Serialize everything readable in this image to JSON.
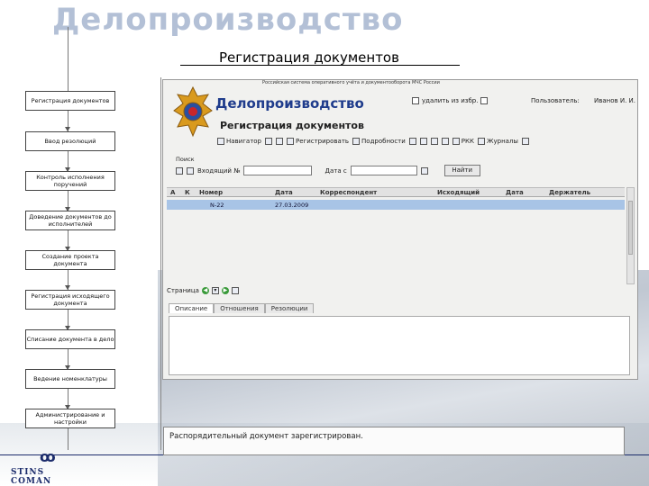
{
  "slide": {
    "title": "Делопроизводство",
    "subtitle": "Регистрация документов"
  },
  "process_steps": [
    "Регистрация документов",
    "Ввод резолюций",
    "Контроль исполнения поручений",
    "Доведение документов до исполнителей",
    "Создание проекта документа",
    "Регистрация исходящего документа",
    "Списание документа в дело",
    "Ведение номенклатуры",
    "Администрирование и настройки"
  ],
  "logo": {
    "mark": "ꝏ",
    "text": "STINS COMAN"
  },
  "app": {
    "top_text": "Российская система оперативного учёта и документооборота МЧС России",
    "title": "Делопроизводство",
    "section": "Регистрация документов",
    "favorites_label": "удалить из избр.",
    "user_label": "Пользователь:",
    "user_name": "Иванов И. И.",
    "toolbar": [
      "Навигатор",
      "Регистрировать",
      "Подробности",
      "РКК",
      "Журналы"
    ],
    "search": {
      "header": "Поиск",
      "incoming_label": "Входящий №",
      "incoming_value": "",
      "date_label": "Дата с",
      "date_value": "",
      "find_button": "Найти"
    },
    "grid": {
      "columns": [
        "А",
        "К",
        "Номер",
        "Дата",
        "Корреспондент",
        "Исходящий",
        "Дата",
        "Держатель"
      ],
      "rows": [
        {
          "number": "N-22",
          "date": "27.03.2009"
        }
      ]
    },
    "pager_label": "Страница",
    "tabs": [
      "Описание",
      "Отношения",
      "Резолюции"
    ]
  },
  "status_message": "Распорядительный документ зарегистрирован."
}
